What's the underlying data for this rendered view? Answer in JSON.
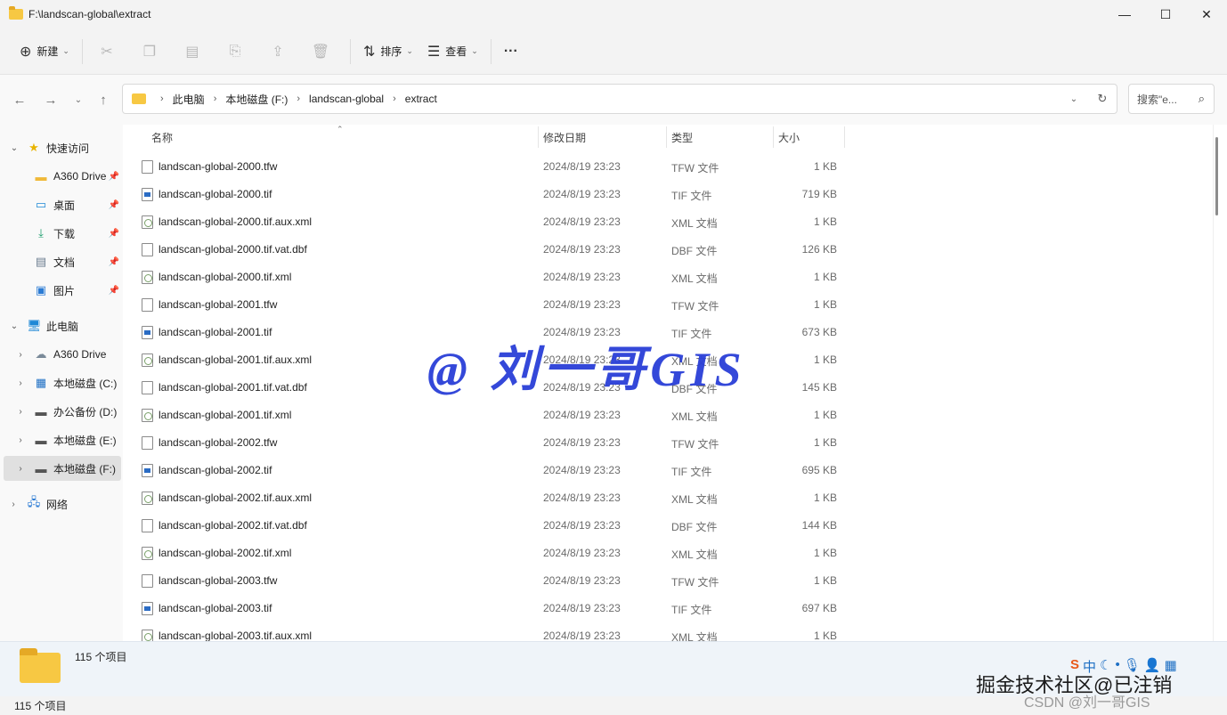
{
  "window": {
    "title": "F:\\landscan-global\\extract",
    "minimize": "—",
    "maximize": "☐",
    "close": "✕"
  },
  "toolbar": {
    "new_label": "新建",
    "sort_label": "排序",
    "view_label": "查看",
    "more_label": "···"
  },
  "address": {
    "crumbs": [
      "此电脑",
      "本地磁盘 (F:)",
      "landscan-global",
      "extract"
    ],
    "search_placeholder": "搜索\"e..."
  },
  "sidebar": {
    "items": [
      {
        "label": "快速访问",
        "icon": "star-icon"
      },
      {
        "label": "A360 Drive",
        "icon": "folder-icon"
      },
      {
        "label": "桌面",
        "icon": "desktop-icon"
      },
      {
        "label": "下载",
        "icon": "download-icon"
      },
      {
        "label": "文档",
        "icon": "document-icon"
      },
      {
        "label": "图片",
        "icon": "picture-icon"
      },
      {
        "label": "此电脑",
        "icon": "computer-icon"
      },
      {
        "label": "A360 Drive",
        "icon": "cloud-drive-icon"
      },
      {
        "label": "本地磁盘 (C:)",
        "icon": "windows-drive-icon"
      },
      {
        "label": "办公备份 (D:)",
        "icon": "drive-icon"
      },
      {
        "label": "本地磁盘 (E:)",
        "icon": "drive-icon"
      },
      {
        "label": "本地磁盘 (F:)",
        "icon": "drive-icon"
      },
      {
        "label": "网络",
        "icon": "network-icon"
      }
    ]
  },
  "columns": {
    "name": "名称",
    "date": "修改日期",
    "type": "类型",
    "size": "大小"
  },
  "files": [
    {
      "name": "landscan-global-2000.tfw",
      "date": "2024/8/19 23:23",
      "type": "TFW 文件",
      "size": "1 KB",
      "kind": "blank"
    },
    {
      "name": "landscan-global-2000.tif",
      "date": "2024/8/19 23:23",
      "type": "TIF 文件",
      "size": "719 KB",
      "kind": "tif"
    },
    {
      "name": "landscan-global-2000.tif.aux.xml",
      "date": "2024/8/19 23:23",
      "type": "XML 文档",
      "size": "1 KB",
      "kind": "xml"
    },
    {
      "name": "landscan-global-2000.tif.vat.dbf",
      "date": "2024/8/19 23:23",
      "type": "DBF 文件",
      "size": "126 KB",
      "kind": "blank"
    },
    {
      "name": "landscan-global-2000.tif.xml",
      "date": "2024/8/19 23:23",
      "type": "XML 文档",
      "size": "1 KB",
      "kind": "xml"
    },
    {
      "name": "landscan-global-2001.tfw",
      "date": "2024/8/19 23:23",
      "type": "TFW 文件",
      "size": "1 KB",
      "kind": "blank"
    },
    {
      "name": "landscan-global-2001.tif",
      "date": "2024/8/19 23:23",
      "type": "TIF 文件",
      "size": "673 KB",
      "kind": "tif"
    },
    {
      "name": "landscan-global-2001.tif.aux.xml",
      "date": "2024/8/19 23:23",
      "type": "XML 文档",
      "size": "1 KB",
      "kind": "xml"
    },
    {
      "name": "landscan-global-2001.tif.vat.dbf",
      "date": "2024/8/19 23:23",
      "type": "DBF 文件",
      "size": "145 KB",
      "kind": "blank"
    },
    {
      "name": "landscan-global-2001.tif.xml",
      "date": "2024/8/19 23:23",
      "type": "XML 文档",
      "size": "1 KB",
      "kind": "xml"
    },
    {
      "name": "landscan-global-2002.tfw",
      "date": "2024/8/19 23:23",
      "type": "TFW 文件",
      "size": "1 KB",
      "kind": "blank"
    },
    {
      "name": "landscan-global-2002.tif",
      "date": "2024/8/19 23:23",
      "type": "TIF 文件",
      "size": "695 KB",
      "kind": "tif"
    },
    {
      "name": "landscan-global-2002.tif.aux.xml",
      "date": "2024/8/19 23:23",
      "type": "XML 文档",
      "size": "1 KB",
      "kind": "xml"
    },
    {
      "name": "landscan-global-2002.tif.vat.dbf",
      "date": "2024/8/19 23:23",
      "type": "DBF 文件",
      "size": "144 KB",
      "kind": "blank"
    },
    {
      "name": "landscan-global-2002.tif.xml",
      "date": "2024/8/19 23:23",
      "type": "XML 文档",
      "size": "1 KB",
      "kind": "xml"
    },
    {
      "name": "landscan-global-2003.tfw",
      "date": "2024/8/19 23:23",
      "type": "TFW 文件",
      "size": "1 KB",
      "kind": "blank"
    },
    {
      "name": "landscan-global-2003.tif",
      "date": "2024/8/19 23:23",
      "type": "TIF 文件",
      "size": "697 KB",
      "kind": "tif"
    },
    {
      "name": "landscan-global-2003.tif.aux.xml",
      "date": "2024/8/19 23:23",
      "type": "XML 文档",
      "size": "1 KB",
      "kind": "xml"
    }
  ],
  "watermark_text": "@ 刘一哥GIS",
  "details": {
    "count": "115 个项目"
  },
  "status": {
    "count": "115 个项目"
  },
  "overlay": {
    "juejin": "掘金技术社区@已注销",
    "csdn": "CSDN @刘一哥GIS",
    "ime_lang": "中"
  }
}
